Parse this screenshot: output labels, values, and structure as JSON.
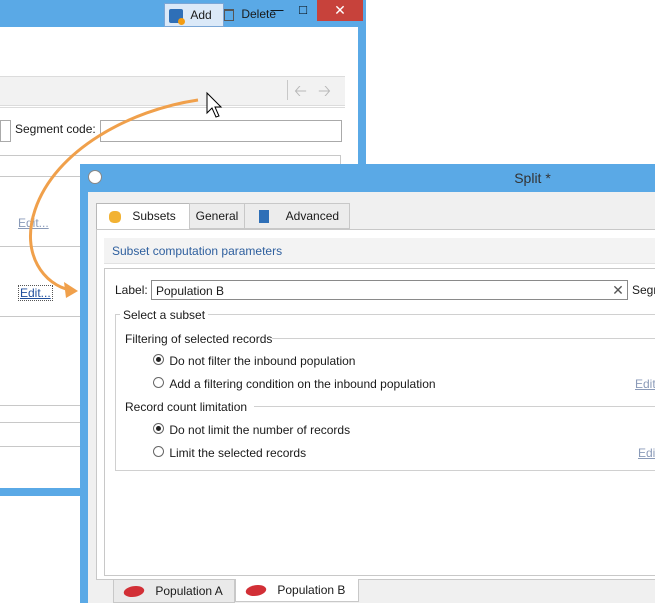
{
  "back_window": {
    "toolbar": {
      "add_label": "Add",
      "delete_label": "Delete"
    },
    "segment_code_label": "Segment code:",
    "edit_link_1": "Edit...",
    "edit_link_2": "Edit..."
  },
  "front_window": {
    "title": "Split *",
    "tabs": [
      {
        "label": "Subsets"
      },
      {
        "label": "General"
      },
      {
        "label": "Advanced"
      }
    ],
    "section_header": "Subset computation parameters",
    "label_field": {
      "label": "Label:",
      "value": "Population B",
      "trailing_label": "Segm"
    },
    "select_subset_title": "Select a subset",
    "filtering_group": {
      "title": "Filtering of selected records",
      "options": [
        {
          "label": "Do not filter the inbound population",
          "selected": true
        },
        {
          "label": "Add a filtering condition on the inbound population",
          "selected": false
        }
      ],
      "edit_link": "Edit"
    },
    "record_group": {
      "title": "Record count limitation",
      "options": [
        {
          "label": "Do not limit the number of records",
          "selected": true
        },
        {
          "label": "Limit the selected records",
          "selected": false
        }
      ],
      "edit_link": "Edi"
    },
    "bottom_tabs": [
      {
        "label": "Population A"
      },
      {
        "label": "Population B"
      }
    ]
  },
  "colors": {
    "window_frame": "#5aa9e6",
    "close_button": "#c7423b",
    "arrow": "#f0a04b",
    "link": "#1f4e9c",
    "population_icon": "#d22f36"
  }
}
